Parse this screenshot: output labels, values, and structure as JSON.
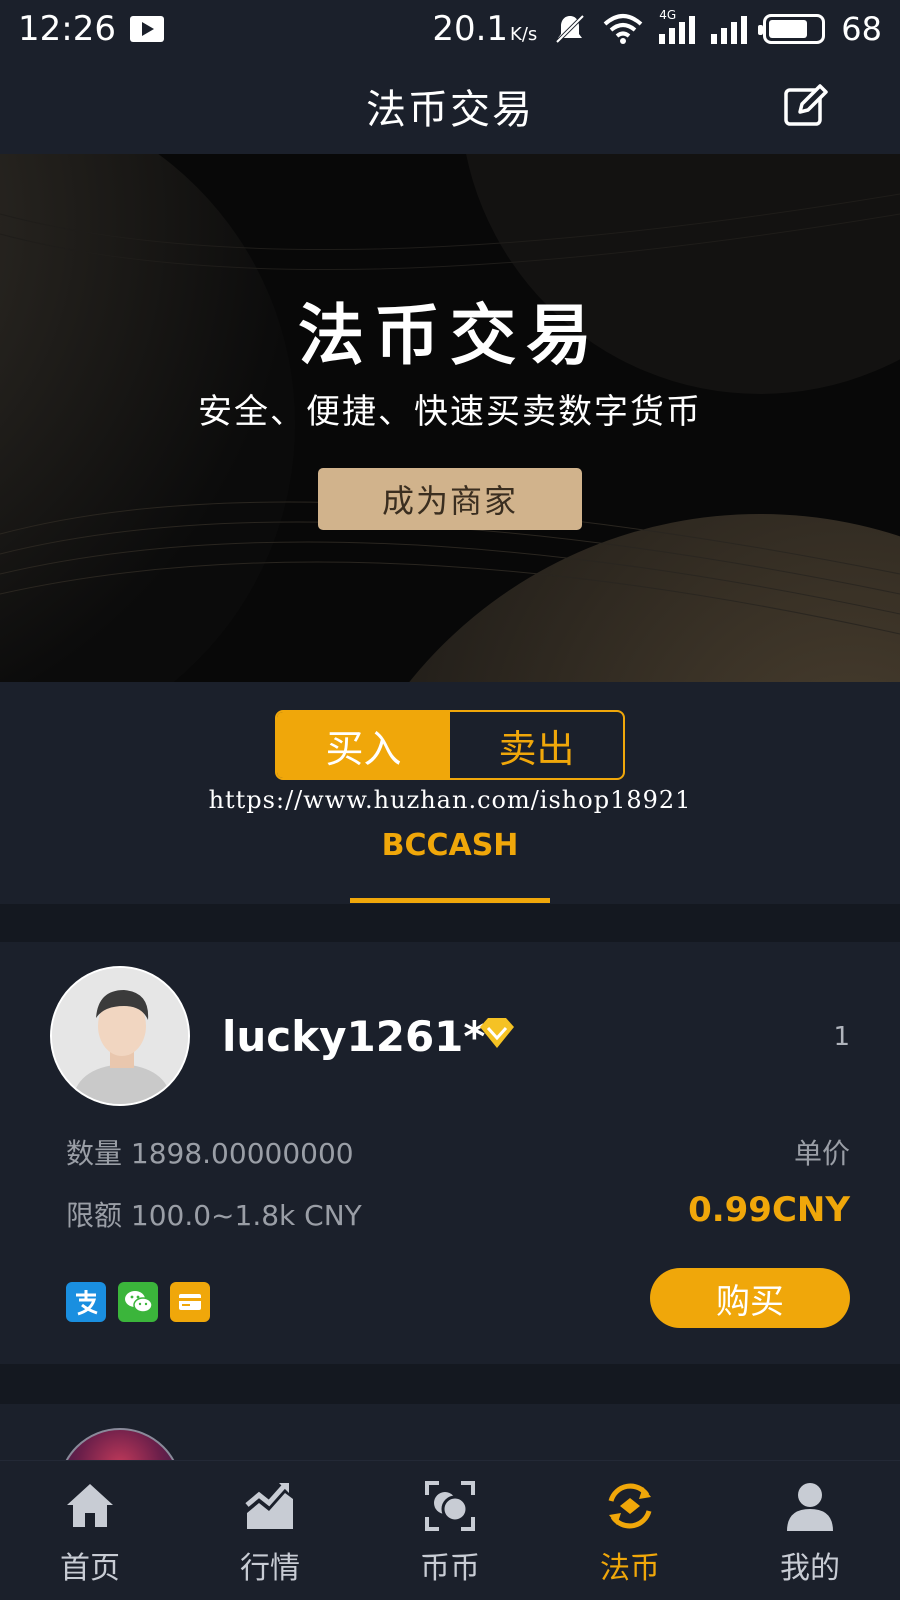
{
  "status_bar": {
    "time": "12:26",
    "speed": "20.1",
    "speed_unit": "K/s",
    "network": "4G",
    "battery": "68"
  },
  "header": {
    "title": "法币交易",
    "edit_icon": "edit-icon"
  },
  "banner": {
    "title": "法币交易",
    "subtitle": "安全、便捷、快速买卖数字货币",
    "button_label": "成为商家"
  },
  "trade_toggle": {
    "buy_label": "买入",
    "sell_label": "卖出",
    "selected": "买入"
  },
  "watermark": "https://www.huzhan.com/ishop18921",
  "coin_tab": "BCCASH",
  "listings": [
    {
      "username": "lucky1261**",
      "rank": "1",
      "quantity_text": "数量 1898.00000000",
      "limit_text": "限额 100.0~1.8k CNY",
      "price_label": "单价",
      "price": "0.99CNY",
      "payment_methods": [
        "alipay-icon",
        "wechat-pay-icon",
        "bank-card-icon"
      ],
      "buy_label": "购买"
    }
  ],
  "bottom_nav": [
    {
      "label": "首页",
      "icon": "home-icon"
    },
    {
      "label": "行情",
      "icon": "market-chart-icon"
    },
    {
      "label": "币币",
      "icon": "coin-exchange-icon"
    },
    {
      "label": "法币",
      "icon": "fiat-exchange-icon",
      "active": true
    },
    {
      "label": "我的",
      "icon": "user-profile-icon"
    }
  ],
  "colors": {
    "accent": "#f0a70a",
    "background": "#1b202b",
    "banner_button": "#d1b38c"
  }
}
